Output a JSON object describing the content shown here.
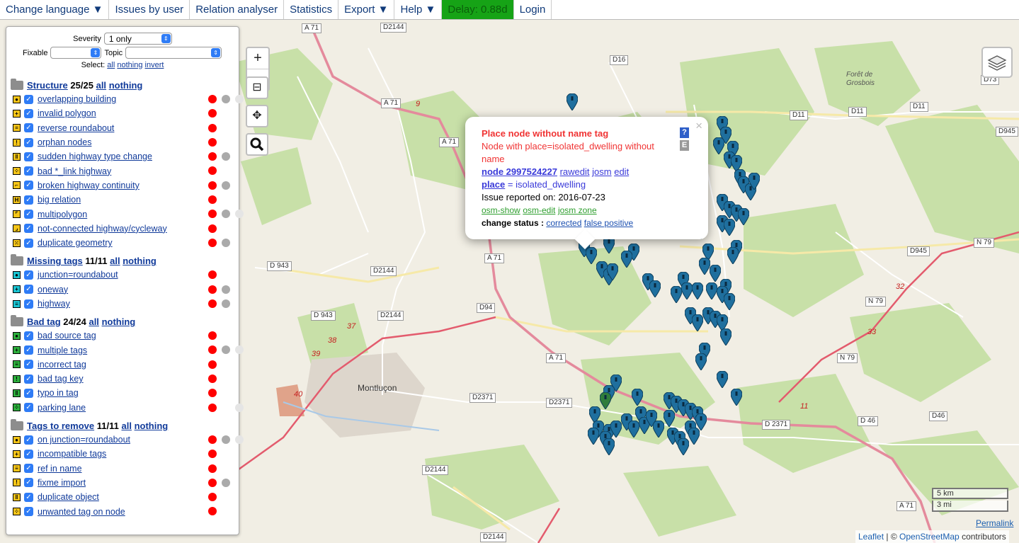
{
  "menu": [
    "Change language ▼",
    "Issues by user",
    "Relation analyser",
    "Statistics",
    "Export ▼",
    "Help ▼",
    "Delay: 0.88d",
    "Login"
  ],
  "filters": {
    "severity_label": "Severity",
    "severity_value": "1 only",
    "fixable_label": "Fixable",
    "fixable_value": "",
    "topic_label": "Topic",
    "topic_value": "",
    "select_label": "Select:",
    "select_all": "all",
    "select_nothing": "nothing",
    "select_invert": "invert"
  },
  "categories": [
    {
      "name": "Structure",
      "count": "25/25",
      "all": "all",
      "nothing": "nothing",
      "items": [
        {
          "label": "overlapping building",
          "dots": [
            "r",
            "g",
            "l"
          ]
        },
        {
          "label": "invalid polygon",
          "dots": [
            "r"
          ]
        },
        {
          "label": "reverse roundabout",
          "dots": [
            "r"
          ]
        },
        {
          "label": "orphan nodes",
          "dots": [
            "r"
          ]
        },
        {
          "label": "sudden highway type change",
          "dots": [
            "r",
            "g"
          ]
        },
        {
          "label": "bad *_link highway",
          "dots": [
            "r"
          ]
        },
        {
          "label": "broken highway continuity",
          "dots": [
            "r",
            "g"
          ]
        },
        {
          "label": "big relation",
          "dots": [
            "r"
          ]
        },
        {
          "label": "multipolygon",
          "dots": [
            "r",
            "g",
            "l"
          ]
        },
        {
          "label": "not-connected highway/cycleway",
          "dots": [
            "r"
          ]
        },
        {
          "label": "duplicate geometry",
          "dots": [
            "r",
            "g"
          ]
        }
      ]
    },
    {
      "name": "Missing tags",
      "count": "11/11",
      "all": "all",
      "nothing": "nothing",
      "items": [
        {
          "label": "junction=roundabout",
          "dots": [
            "r"
          ]
        },
        {
          "label": "oneway",
          "dots": [
            "r",
            "g"
          ]
        },
        {
          "label": "highway",
          "dots": [
            "r",
            "g"
          ]
        }
      ]
    },
    {
      "name": "Bad tag",
      "count": "24/24",
      "all": "all",
      "nothing": "nothing",
      "items": [
        {
          "label": "bad source tag",
          "dots": [
            "r"
          ]
        },
        {
          "label": "multiple tags",
          "dots": [
            "r",
            "g",
            "l"
          ]
        },
        {
          "label": "incorrect tag",
          "dots": [
            "r"
          ]
        },
        {
          "label": "bad tag key",
          "dots": [
            "r"
          ]
        },
        {
          "label": "typo in tag",
          "dots": [
            "r"
          ]
        },
        {
          "label": "parking lane",
          "dots": [
            "r",
            "n",
            "l"
          ]
        }
      ]
    },
    {
      "name": "Tags to remove",
      "count": "11/11",
      "all": "all",
      "nothing": "nothing",
      "items": [
        {
          "label": "on junction=roundabout",
          "dots": [
            "r",
            "g",
            "l"
          ]
        },
        {
          "label": "incompatible tags",
          "dots": [
            "r"
          ]
        },
        {
          "label": "ref in name",
          "dots": [
            "r"
          ]
        },
        {
          "label": "fixme import",
          "dots": [
            "r",
            "g"
          ]
        },
        {
          "label": "duplicate object",
          "dots": [
            "r"
          ]
        },
        {
          "label": "unwanted tag on node",
          "dots": [
            "r"
          ]
        }
      ]
    }
  ],
  "popup": {
    "title": "Place node without name tag",
    "subtitle": "Node with place=isolated_dwelling without name",
    "node_link": "node 2997524227",
    "rawedit": "rawedit",
    "josm": "josm",
    "edit": "edit",
    "tag_key": "place",
    "tag_value": "= isolated_dwelling",
    "reported": "Issue reported on: 2016-07-23",
    "osm_show": "osm-show",
    "osm_edit": "osm-edit",
    "josm_zone": "josm zone",
    "status_label": "change status :",
    "corrected": "corrected",
    "false_positive": "false positive",
    "close": "×",
    "help": "?",
    "e": "E"
  },
  "map": {
    "roads": [
      "A 71",
      "D2144",
      "A 71",
      "A 71",
      "D16",
      "D11",
      "D11",
      "D11",
      "D73",
      "D945",
      "D 943",
      "D2144",
      "A 71",
      "D945",
      "N 79",
      "D 943",
      "D2144",
      "D94",
      "N 79",
      "A 71",
      "N 79",
      "D2371",
      "D2371",
      "D 2371",
      "D 46",
      "D46",
      "D2144",
      "A 71",
      "D2144"
    ],
    "places": [
      "Montluçon",
      "Forêt de Grosbois"
    ],
    "numbers": [
      "9",
      "37",
      "38",
      "39",
      "40",
      "32",
      "33",
      "11"
    ]
  },
  "controls": {
    "zoom_in": "+",
    "zoom_out": "−",
    "minimize": "⊟",
    "locate": "✥",
    "search": "search"
  },
  "scale": {
    "km": "5 km",
    "mi": "3 mi"
  },
  "footer": {
    "permalink": "Permalink",
    "leaflet": "Leaflet",
    "sep": "| ©",
    "osm": "OpenStreetMap",
    "contributors": "contributors"
  },
  "colors": {
    "marker": "#1f6f9e",
    "road_major": "#e08a9a",
    "forest": "#c7dfa7",
    "issue_red": "#ff0000"
  }
}
